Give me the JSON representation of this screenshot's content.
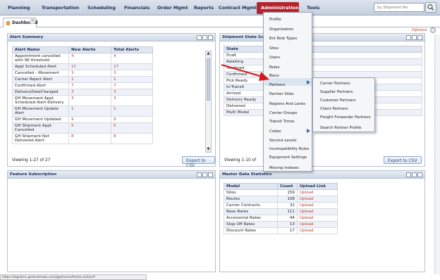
{
  "nav": {
    "items": [
      "Planning",
      "Transportation",
      "Scheduling",
      "Financials",
      "Order Mgmt",
      "Reports",
      "Contract Mgmt",
      "Administration",
      "Tools"
    ],
    "search_placeholder": "by Shipment No"
  },
  "tabs": {
    "dashboard": "Dashboard",
    "close": "x"
  },
  "options_label": "Options",
  "alert_summary": {
    "title": "Alert Summary",
    "columns": [
      "Alert Name",
      "New Alerts",
      "Total Alerts"
    ],
    "rows": [
      [
        "Appointment cancelled with 96 threshold",
        "4",
        "4"
      ],
      [
        "Appt Scheduled Alert",
        "17",
        "17"
      ],
      [
        "Cancelled - Movement",
        "3",
        "3"
      ],
      [
        "Carrier Reject Alert",
        "1",
        "1"
      ],
      [
        "Confirmed Alert",
        "7",
        "7"
      ],
      [
        "DeliveryDateChanged",
        "3",
        "3"
      ],
      [
        "GH Movement Appt Scheduled Alert-Delivery",
        "3",
        "3"
      ],
      [
        "GH Movement Update Alert",
        "1",
        "1"
      ],
      [
        "GH Movement Updated",
        "9",
        "9"
      ],
      [
        "GH Shipment Appt Cancelled",
        "5",
        "5"
      ],
      [
        "GH Shipment Not Delivered Alert",
        "8",
        "8"
      ]
    ],
    "footer": "Viewing 1-27 of 27",
    "export": "Export to CSV"
  },
  "shipment_state": {
    "title": "Shipment State Su",
    "column": "State",
    "rows": [
      "Draft",
      "Awaiting",
      "Tendered",
      "Confirmed",
      "Pick Ready",
      "In-Transit",
      "Arrived",
      "Delivery Ready",
      "Delivered",
      "Multi Modal"
    ],
    "footer": "Viewing 1-10 of",
    "export": "Export to CSV"
  },
  "feature_subscription": {
    "title": "Feature Subscription"
  },
  "master_data": {
    "title": "Master Data Statistics",
    "columns": [
      "Model",
      "Count",
      "Upload Link"
    ],
    "rows": [
      [
        "Sites",
        "159",
        "Upload"
      ],
      [
        "Routes",
        "108",
        "Upload"
      ],
      [
        "Carrier Contracts",
        "31",
        "Upload"
      ],
      [
        "Base Rates",
        "111",
        "Upload"
      ],
      [
        "Accessorial Rates",
        "44",
        "Upload"
      ],
      [
        "Stop Off Rates",
        "13",
        "Upload"
      ],
      [
        "Discount Rates",
        "17",
        "Upload"
      ]
    ]
  },
  "admin_menu": [
    "Profile",
    "Organization",
    "Ent Role Types",
    "Sites",
    "Users",
    "Roles",
    "Beno",
    "Partners",
    "Partner Sites",
    "Regions And Lanes",
    "Carrier Groups",
    "Transit Times",
    "Codes",
    "Service Levels",
    "Incompatibility Rules",
    "Equipment Settings",
    "Moving Indexes"
  ],
  "partners_submenu": [
    "Carrier Partners",
    "Supplier Partners",
    "Customer Partners",
    "Client Partners",
    "Freight Forwarder Partners",
    "Search Partner Profile"
  ],
  "status_url": "https://logistics.greenstreak.com/gw/home/home.action#",
  "colors": {
    "accent": "#b5242d",
    "header": "#cdd7e6",
    "link_red": "#c0392b"
  }
}
